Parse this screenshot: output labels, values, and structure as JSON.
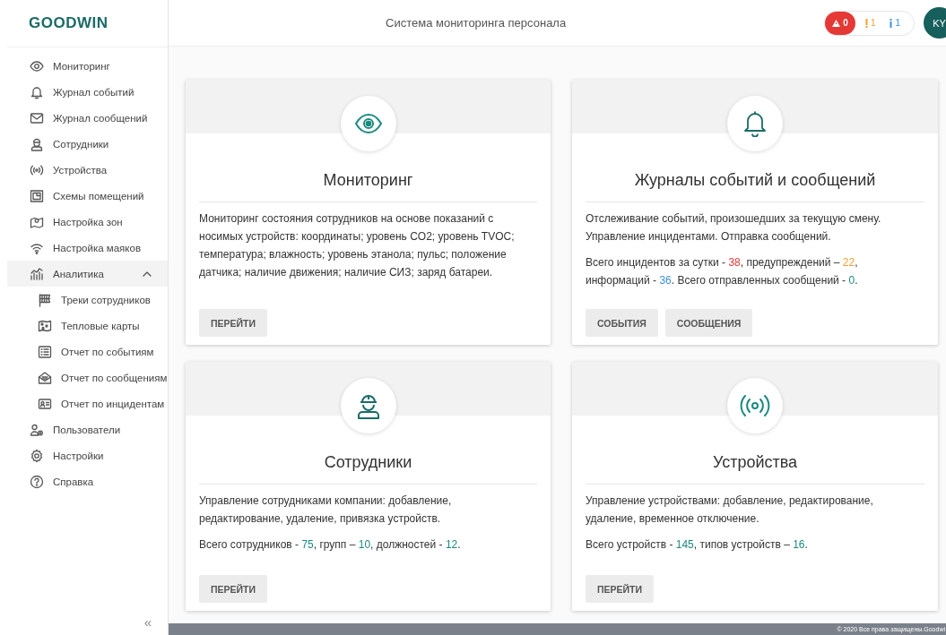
{
  "logo": "GOODWIN",
  "sidebar": {
    "items": [
      {
        "label": "Мониторинг"
      },
      {
        "label": "Журнал событий"
      },
      {
        "label": "Журнал сообщений"
      },
      {
        "label": "Сотрудники"
      },
      {
        "label": "Устройства"
      },
      {
        "label": "Схемы помещений"
      },
      {
        "label": "Настройка зон"
      },
      {
        "label": "Настройка маяков"
      },
      {
        "label": "Аналитика",
        "expanded": true,
        "children": [
          {
            "label": "Треки сотрудников"
          },
          {
            "label": "Тепловые карты"
          },
          {
            "label": "Отчет по событиям"
          },
          {
            "label": "Отчет по сообщениям"
          },
          {
            "label": "Отчет по инцидентам"
          }
        ]
      },
      {
        "label": "Пользователи"
      },
      {
        "label": "Настройки"
      },
      {
        "label": "Справка"
      }
    ],
    "collapse": "«"
  },
  "header": {
    "title": "Система мониторинга персонала",
    "alerts": "0",
    "warnings": "1",
    "infos": "1",
    "avatar": "KY"
  },
  "cards": [
    {
      "title": "Мониторинг",
      "description": "Мониторинг состояния сотрудников на основе показаний с носимых устройств: координаты; уровень CO2; уровень TVOC; температура; влажность; уровень этанола; пульс; положение датчика; наличие движения; наличие СИЗ; заряд батареи.",
      "buttons": [
        "ПЕРЕЙТИ"
      ]
    },
    {
      "title": "Журналы событий и сообщений",
      "description": "Отслеживание событий, произошедших за текущую смену. Управление инцидентами. Отправка сообщений.",
      "stats": [
        {
          "text": "Всего инцидентов за сутки - "
        },
        {
          "text": "38",
          "color": "#e53935"
        },
        {
          "text": ", предупреждений – "
        },
        {
          "text": "22",
          "color": "#f0a030"
        },
        {
          "text": ", информаций - "
        },
        {
          "text": "36",
          "color": "#3d8fd6"
        },
        {
          "text": ". Всего отправленных сообщений - "
        },
        {
          "text": "0",
          "color": "#1a8a80"
        },
        {
          "text": "."
        }
      ],
      "buttons": [
        "СОБЫТИЯ",
        "СООБЩЕНИЯ"
      ]
    },
    {
      "title": "Сотрудники",
      "description": "Управление сотрудниками компании: добавление, редактирование, удаление, привязка устройств.",
      "stats": [
        {
          "text": "Всего сотрудников - "
        },
        {
          "text": "75",
          "color": "#1a8a80"
        },
        {
          "text": ", групп – "
        },
        {
          "text": "10",
          "color": "#1a8a80"
        },
        {
          "text": ", должностей - "
        },
        {
          "text": "12",
          "color": "#1a8a80"
        },
        {
          "text": "."
        }
      ],
      "buttons": [
        "ПЕРЕЙТИ"
      ]
    },
    {
      "title": "Устройства",
      "description": "Управление устройствами: добавление, редактирование, удаление, временное отключение.",
      "stats": [
        {
          "text": "Всего устройств - "
        },
        {
          "text": "145",
          "color": "#1a8a80"
        },
        {
          "text": ", типов устройств – "
        },
        {
          "text": "16",
          "color": "#1a8a80"
        },
        {
          "text": "."
        }
      ],
      "buttons": [
        "ПЕРЕЙТИ"
      ]
    }
  ],
  "footer": "© 2020 Все права защищены.Goodwi"
}
